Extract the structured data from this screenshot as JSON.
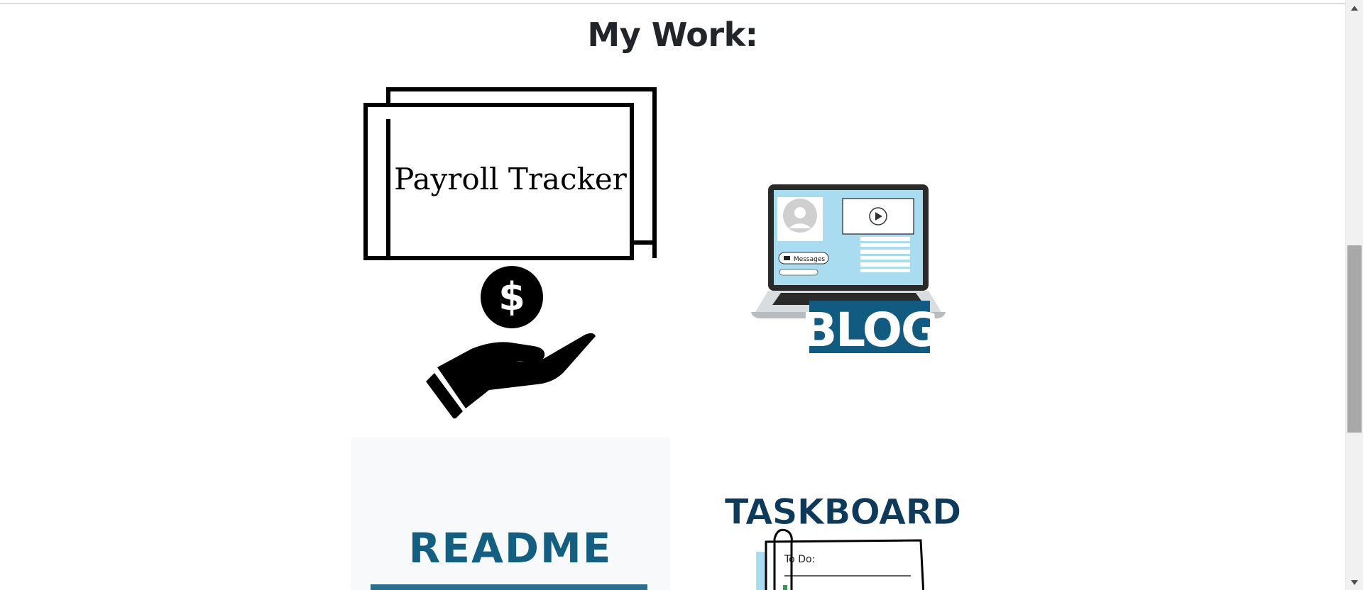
{
  "header": {
    "title": "My Work:"
  },
  "projects": [
    {
      "id": "payroll",
      "label": "Payroll Tracker",
      "icon": "dollar-hand-icon"
    },
    {
      "id": "blog",
      "label": "BLOG",
      "messages_label": "Messages",
      "icon": "laptop-icon"
    },
    {
      "id": "readme",
      "label": "README"
    },
    {
      "id": "taskboard",
      "label": "TASKBOARD",
      "todo_label": "To Do:"
    }
  ],
  "colors": {
    "title": "#212529",
    "blog_badge": "#115a80",
    "readme_text": "#145e82",
    "taskboard_text": "#0d3a5a",
    "scroll_thumb": "#a8a8a8"
  }
}
